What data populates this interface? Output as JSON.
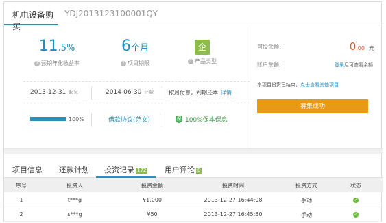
{
  "header": {
    "active_tab": "机电设备购买",
    "order_no": "YDJ2013123100001QY"
  },
  "stats": {
    "rate_value": "11",
    "rate_suffix": ".5%",
    "rate_label": "预期年化收益率",
    "term_value": "6",
    "term_unit": "个月",
    "term_label": "项目期限",
    "product_badge": "企",
    "product_label": "产品类型",
    "help_glyph": "?"
  },
  "dates": {
    "start": "2013-12-31",
    "start_tag": "起息",
    "end": "2014-06-30",
    "end_tag": "还款",
    "repay_method": "按月付息，到期还本",
    "details_link": "详情"
  },
  "progress": {
    "percent": 100,
    "percent_label": "100%",
    "contract_link": "借款协议(范文)",
    "guarantee": "100%保本保息",
    "guarantee_glyph": "保"
  },
  "side": {
    "investable_label": "可投余额:",
    "investable_int": "0",
    "investable_dec": ".00",
    "investable_unit": "元",
    "account_label": "账户余额:",
    "login_link": "登录",
    "login_suffix": "后可查看余额",
    "ended_text": "本项目投资已结束，",
    "ended_link": "点击查看其他项目",
    "raise_button": "募集成功"
  },
  "tabs": [
    {
      "label": "项目信息",
      "count": ""
    },
    {
      "label": "还款计划",
      "count": ""
    },
    {
      "label": "投资记录",
      "count": "172"
    },
    {
      "label": "用户评论",
      "count": "0"
    }
  ],
  "table": {
    "headers": [
      "序号",
      "投资人",
      "投资金额",
      "投资时间",
      "投资方式",
      "状态"
    ],
    "rows": [
      {
        "no": "1",
        "investor": "t***g",
        "amount": "¥1,000",
        "time": "2013-12-27 16:44:08",
        "method": "手动",
        "status": "ok"
      },
      {
        "no": "2",
        "investor": "s***g",
        "amount": "¥50",
        "time": "2013-12-27 16:45:50",
        "method": "手动",
        "status": "ok"
      }
    ]
  },
  "colors": {
    "accent_blue": "#2a8fbd",
    "button_orange": "#e79a13",
    "badge_green": "#8dbb4c",
    "balance_red": "#e2592a"
  },
  "icons": {
    "status_ok": "check-circle-icon"
  }
}
